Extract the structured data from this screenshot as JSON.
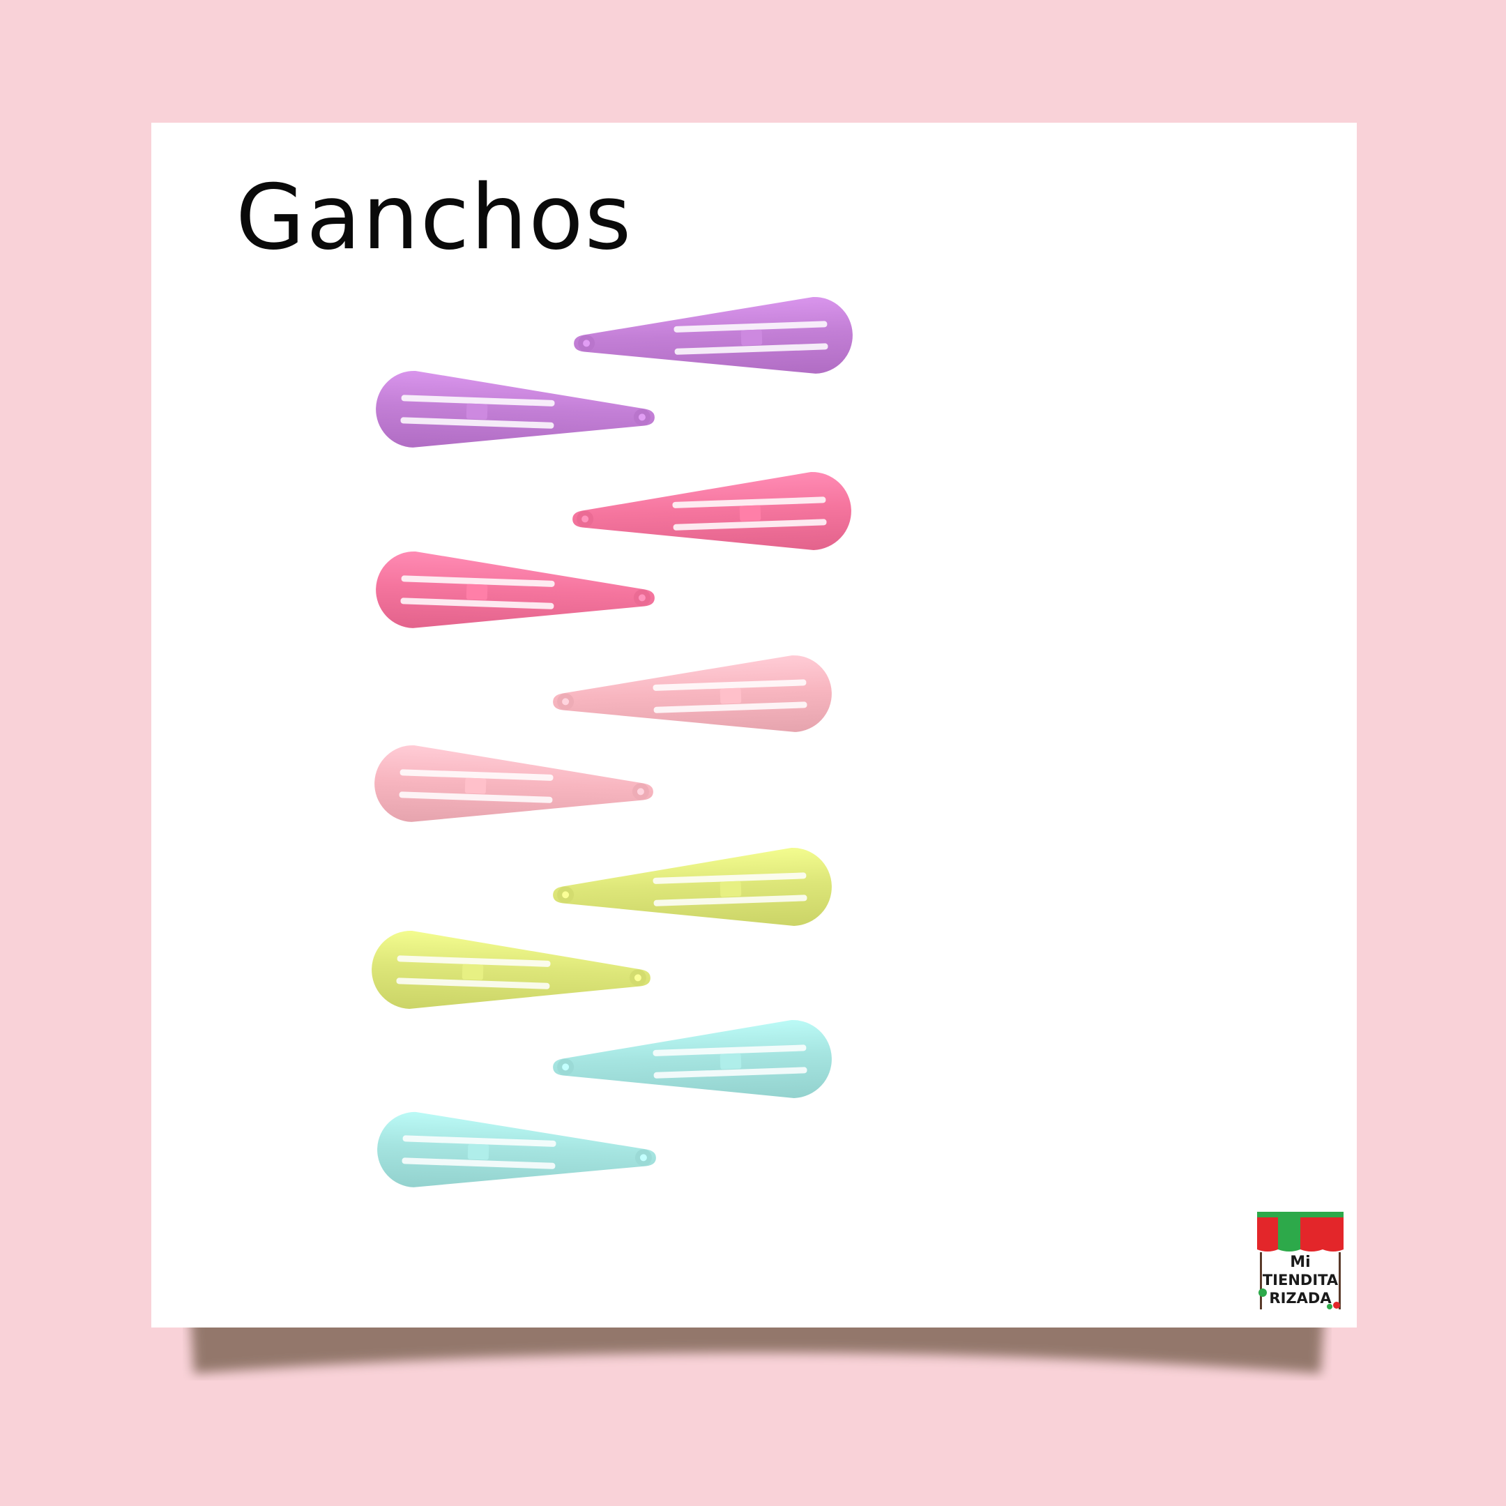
{
  "title": "Ganchos",
  "colors": {
    "background": "#f9d2d8",
    "card": "#ffffff",
    "shadow": "#8e7366",
    "title_text": "#0a0a0a"
  },
  "clips": [
    {
      "name": "clip-purple-1",
      "color": "#c37fd6",
      "pointing": "left"
    },
    {
      "name": "clip-purple-2",
      "color": "#c37fd6",
      "pointing": "right"
    },
    {
      "name": "clip-hotpink-1",
      "color": "#f5759e",
      "pointing": "left"
    },
    {
      "name": "clip-hotpink-2",
      "color": "#f5759e",
      "pointing": "right"
    },
    {
      "name": "clip-lightpink-1",
      "color": "#f8b6c0",
      "pointing": "left"
    },
    {
      "name": "clip-lightpink-2",
      "color": "#f8b6c0",
      "pointing": "right"
    },
    {
      "name": "clip-yellow-1",
      "color": "#dde679",
      "pointing": "left"
    },
    {
      "name": "clip-yellow-2",
      "color": "#dde679",
      "pointing": "right"
    },
    {
      "name": "clip-aqua-1",
      "color": "#a5e4e0",
      "pointing": "left"
    },
    {
      "name": "clip-aqua-2",
      "color": "#a5e4e0",
      "pointing": "right"
    }
  ],
  "logo": {
    "line1": "Mi",
    "line2": "TIENDITA",
    "line3": "RIZADA",
    "awning_colors": [
      "#e3262a",
      "#2da94a"
    ]
  }
}
